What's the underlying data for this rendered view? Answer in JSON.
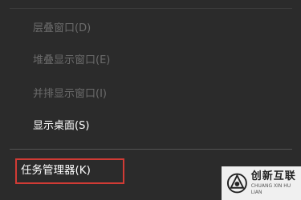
{
  "menu": {
    "items": [
      {
        "label": "层叠窗口(D)",
        "enabled": false
      },
      {
        "label": "堆叠显示窗口(E)",
        "enabled": false
      },
      {
        "label": "并排显示窗口(I)",
        "enabled": false
      },
      {
        "label": "显示桌面(S)",
        "enabled": true
      },
      {
        "label": "任务管理器(K)",
        "enabled": true,
        "highlighted": true
      }
    ]
  },
  "watermark": {
    "name": "创新互联",
    "subtitle": "CHUANG XIN HU LIAN"
  },
  "colors": {
    "menu_bg": "#2b2b2b",
    "disabled_text": "#6b6b6b",
    "enabled_text": "#ffffff",
    "highlight_border": "#d13b35"
  }
}
